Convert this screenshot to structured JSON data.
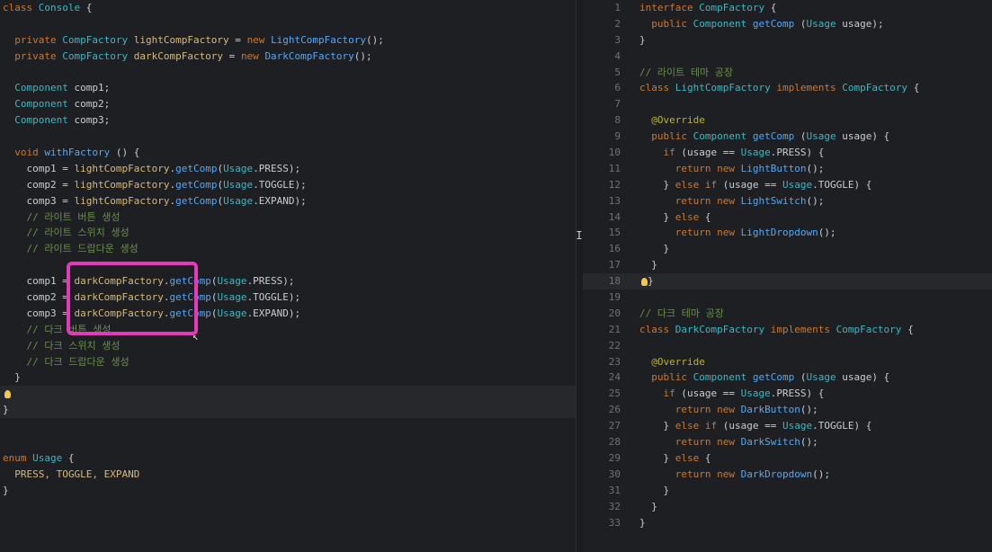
{
  "left": {
    "lines": [
      [
        {
          "t": "class ",
          "c": "kw"
        },
        {
          "t": "Console ",
          "c": "ty"
        },
        {
          "t": "{",
          "c": "pl"
        }
      ],
      [],
      [
        {
          "t": "  private ",
          "c": "kw"
        },
        {
          "t": "CompFactory ",
          "c": "ty"
        },
        {
          "t": "lightCompFactory",
          "c": "var"
        },
        {
          "t": " = ",
          "c": "pl"
        },
        {
          "t": "new ",
          "c": "kw"
        },
        {
          "t": "LightCompFactory",
          "c": "fn"
        },
        {
          "t": "();",
          "c": "pl"
        }
      ],
      [
        {
          "t": "  private ",
          "c": "kw"
        },
        {
          "t": "CompFactory ",
          "c": "ty"
        },
        {
          "t": "darkCompFactory",
          "c": "var"
        },
        {
          "t": " = ",
          "c": "pl"
        },
        {
          "t": "new ",
          "c": "kw"
        },
        {
          "t": "DarkCompFactory",
          "c": "fn"
        },
        {
          "t": "();",
          "c": "pl"
        }
      ],
      [],
      [
        {
          "t": "  Component ",
          "c": "ty"
        },
        {
          "t": "comp1;",
          "c": "pl"
        }
      ],
      [
        {
          "t": "  Component ",
          "c": "ty"
        },
        {
          "t": "comp2;",
          "c": "pl"
        }
      ],
      [
        {
          "t": "  Component ",
          "c": "ty"
        },
        {
          "t": "comp3;",
          "c": "pl"
        }
      ],
      [],
      [
        {
          "t": "  void ",
          "c": "kw"
        },
        {
          "t": "withFactory",
          "c": "fn"
        },
        {
          "t": " () {",
          "c": "pl"
        }
      ],
      [
        {
          "t": "    comp1 = ",
          "c": "pl"
        },
        {
          "t": "lightCompFactory",
          "c": "var"
        },
        {
          "t": ".",
          "c": "pl"
        },
        {
          "t": "getComp",
          "c": "fn"
        },
        {
          "t": "(",
          "c": "pl"
        },
        {
          "t": "Usage",
          "c": "ty"
        },
        {
          "t": ".PRESS);",
          "c": "pl"
        }
      ],
      [
        {
          "t": "    comp2 = ",
          "c": "pl"
        },
        {
          "t": "lightCompFactory",
          "c": "var"
        },
        {
          "t": ".",
          "c": "pl"
        },
        {
          "t": "getComp",
          "c": "fn"
        },
        {
          "t": "(",
          "c": "pl"
        },
        {
          "t": "Usage",
          "c": "ty"
        },
        {
          "t": ".TOGGLE);",
          "c": "pl"
        }
      ],
      [
        {
          "t": "    comp3 = ",
          "c": "pl"
        },
        {
          "t": "lightCompFactory",
          "c": "var"
        },
        {
          "t": ".",
          "c": "pl"
        },
        {
          "t": "getComp",
          "c": "fn"
        },
        {
          "t": "(",
          "c": "pl"
        },
        {
          "t": "Usage",
          "c": "ty"
        },
        {
          "t": ".EXPAND);",
          "c": "pl"
        }
      ],
      [
        {
          "t": "    // 라이트 버튼 생성",
          "c": "cm"
        }
      ],
      [
        {
          "t": "    // 라이트 스위치 생성",
          "c": "cm"
        }
      ],
      [
        {
          "t": "    // 라이트 드랍다운 생성",
          "c": "cm"
        }
      ],
      [],
      [
        {
          "t": "    comp1 = ",
          "c": "pl"
        },
        {
          "t": "darkCompFactory",
          "c": "var"
        },
        {
          "t": ".",
          "c": "pl"
        },
        {
          "t": "getComp",
          "c": "fn"
        },
        {
          "t": "(",
          "c": "pl"
        },
        {
          "t": "Usage",
          "c": "ty"
        },
        {
          "t": ".PRESS);",
          "c": "pl"
        }
      ],
      [
        {
          "t": "    comp2 = ",
          "c": "pl"
        },
        {
          "t": "darkCompFactory",
          "c": "var"
        },
        {
          "t": ".",
          "c": "pl"
        },
        {
          "t": "getComp",
          "c": "fn"
        },
        {
          "t": "(",
          "c": "pl"
        },
        {
          "t": "Usage",
          "c": "ty"
        },
        {
          "t": ".TOGGLE);",
          "c": "pl"
        }
      ],
      [
        {
          "t": "    comp3 = ",
          "c": "pl"
        },
        {
          "t": "darkCompFactory",
          "c": "var"
        },
        {
          "t": ".",
          "c": "pl"
        },
        {
          "t": "getComp",
          "c": "fn"
        },
        {
          "t": "(",
          "c": "pl"
        },
        {
          "t": "Usage",
          "c": "ty"
        },
        {
          "t": ".EXPAND);",
          "c": "pl"
        }
      ],
      [
        {
          "t": "    // 다크 버튼 생성",
          "c": "cm"
        }
      ],
      [
        {
          "t": "    // 다크 스위치 생성",
          "c": "cm"
        }
      ],
      [
        {
          "t": "    // 다크 드랍다운 생성",
          "c": "cm"
        }
      ],
      [
        {
          "t": "  }",
          "c": "pl"
        }
      ],
      [
        {
          "t": "",
          "c": "pl"
        }
      ],
      [
        {
          "t": "}",
          "c": "pl"
        }
      ],
      [],
      [],
      [
        {
          "t": "enum ",
          "c": "kw"
        },
        {
          "t": "Usage ",
          "c": "ty"
        },
        {
          "t": "{",
          "c": "pl"
        }
      ],
      [
        {
          "t": "  PRESS, TOGGLE, EXPAND",
          "c": "var"
        }
      ],
      [
        {
          "t": "}",
          "c": "pl"
        }
      ]
    ],
    "bulb_line": 24,
    "highlight_lines": [
      24,
      25
    ]
  },
  "right": {
    "lines": [
      [
        {
          "t": "interface ",
          "c": "kw"
        },
        {
          "t": "CompFactory ",
          "c": "ty"
        },
        {
          "t": "{",
          "c": "pl"
        }
      ],
      [
        {
          "t": "  public ",
          "c": "kw"
        },
        {
          "t": "Component ",
          "c": "ty"
        },
        {
          "t": "getComp",
          "c": "fn"
        },
        {
          "t": " (",
          "c": "pl"
        },
        {
          "t": "Usage ",
          "c": "ty"
        },
        {
          "t": "usage);",
          "c": "pl"
        }
      ],
      [
        {
          "t": "}",
          "c": "pl"
        }
      ],
      [],
      [
        {
          "t": "// 라이트 테마 공장",
          "c": "cm"
        }
      ],
      [
        {
          "t": "class ",
          "c": "kw"
        },
        {
          "t": "LightCompFactory ",
          "c": "ty"
        },
        {
          "t": "implements ",
          "c": "kw"
        },
        {
          "t": "CompFactory ",
          "c": "ty"
        },
        {
          "t": "{",
          "c": "pl"
        }
      ],
      [],
      [
        {
          "t": "  @Override",
          "c": "an"
        }
      ],
      [
        {
          "t": "  public ",
          "c": "kw"
        },
        {
          "t": "Component ",
          "c": "ty"
        },
        {
          "t": "getComp",
          "c": "fn"
        },
        {
          "t": " (",
          "c": "pl"
        },
        {
          "t": "Usage ",
          "c": "ty"
        },
        {
          "t": "usage) {",
          "c": "pl"
        }
      ],
      [
        {
          "t": "    if ",
          "c": "kw"
        },
        {
          "t": "(usage == ",
          "c": "pl"
        },
        {
          "t": "Usage",
          "c": "ty"
        },
        {
          "t": ".PRESS) {",
          "c": "pl"
        }
      ],
      [
        {
          "t": "      return new ",
          "c": "kw"
        },
        {
          "t": "LightButton",
          "c": "fn"
        },
        {
          "t": "();",
          "c": "pl"
        }
      ],
      [
        {
          "t": "    } ",
          "c": "pl"
        },
        {
          "t": "else if ",
          "c": "kw"
        },
        {
          "t": "(usage == ",
          "c": "pl"
        },
        {
          "t": "Usage",
          "c": "ty"
        },
        {
          "t": ".TOGGLE) {",
          "c": "pl"
        }
      ],
      [
        {
          "t": "      return new ",
          "c": "kw"
        },
        {
          "t": "LightSwitch",
          "c": "fn"
        },
        {
          "t": "();",
          "c": "pl"
        }
      ],
      [
        {
          "t": "    } ",
          "c": "pl"
        },
        {
          "t": "else ",
          "c": "kw"
        },
        {
          "t": "{",
          "c": "pl"
        }
      ],
      [
        {
          "t": "      return new ",
          "c": "kw"
        },
        {
          "t": "LightDropdown",
          "c": "fn"
        },
        {
          "t": "();",
          "c": "pl"
        }
      ],
      [
        {
          "t": "    }",
          "c": "pl"
        }
      ],
      [
        {
          "t": "  }",
          "c": "pl"
        }
      ],
      [
        {
          "t": "}",
          "c": "pl"
        }
      ],
      [],
      [
        {
          "t": "// 다크 테마 공장",
          "c": "cm"
        }
      ],
      [
        {
          "t": "class ",
          "c": "kw"
        },
        {
          "t": "DarkCompFactory ",
          "c": "ty"
        },
        {
          "t": "implements ",
          "c": "kw"
        },
        {
          "t": "CompFactory ",
          "c": "ty"
        },
        {
          "t": "{",
          "c": "pl"
        }
      ],
      [],
      [
        {
          "t": "  @Override",
          "c": "an"
        }
      ],
      [
        {
          "t": "  public ",
          "c": "kw"
        },
        {
          "t": "Component ",
          "c": "ty"
        },
        {
          "t": "getComp",
          "c": "fn"
        },
        {
          "t": " (",
          "c": "pl"
        },
        {
          "t": "Usage ",
          "c": "ty"
        },
        {
          "t": "usage) {",
          "c": "pl"
        }
      ],
      [
        {
          "t": "    if ",
          "c": "kw"
        },
        {
          "t": "(usage == ",
          "c": "pl"
        },
        {
          "t": "Usage",
          "c": "ty"
        },
        {
          "t": ".PRESS) {",
          "c": "pl"
        }
      ],
      [
        {
          "t": "      return new ",
          "c": "kw"
        },
        {
          "t": "DarkButton",
          "c": "fn"
        },
        {
          "t": "();",
          "c": "pl"
        }
      ],
      [
        {
          "t": "    } ",
          "c": "pl"
        },
        {
          "t": "else if ",
          "c": "kw"
        },
        {
          "t": "(usage == ",
          "c": "pl"
        },
        {
          "t": "Usage",
          "c": "ty"
        },
        {
          "t": ".TOGGLE) {",
          "c": "pl"
        }
      ],
      [
        {
          "t": "      return new ",
          "c": "kw"
        },
        {
          "t": "DarkSwitch",
          "c": "fn"
        },
        {
          "t": "();",
          "c": "pl"
        }
      ],
      [
        {
          "t": "    } ",
          "c": "pl"
        },
        {
          "t": "else ",
          "c": "kw"
        },
        {
          "t": "{",
          "c": "pl"
        }
      ],
      [
        {
          "t": "      return new ",
          "c": "kw"
        },
        {
          "t": "DarkDropdown",
          "c": "fn"
        },
        {
          "t": "();",
          "c": "pl"
        }
      ],
      [
        {
          "t": "    }",
          "c": "pl"
        }
      ],
      [
        {
          "t": "  }",
          "c": "pl"
        }
      ],
      [
        {
          "t": "}",
          "c": "pl"
        }
      ]
    ],
    "bulb_line": 17,
    "highlight_lines": [
      17
    ]
  },
  "colors": {
    "background": "#1e1f22",
    "highlight_box": "#e23ab8",
    "keyword": "#cc7832",
    "type": "#3fb7c2",
    "comment": "#6b8e4e"
  }
}
